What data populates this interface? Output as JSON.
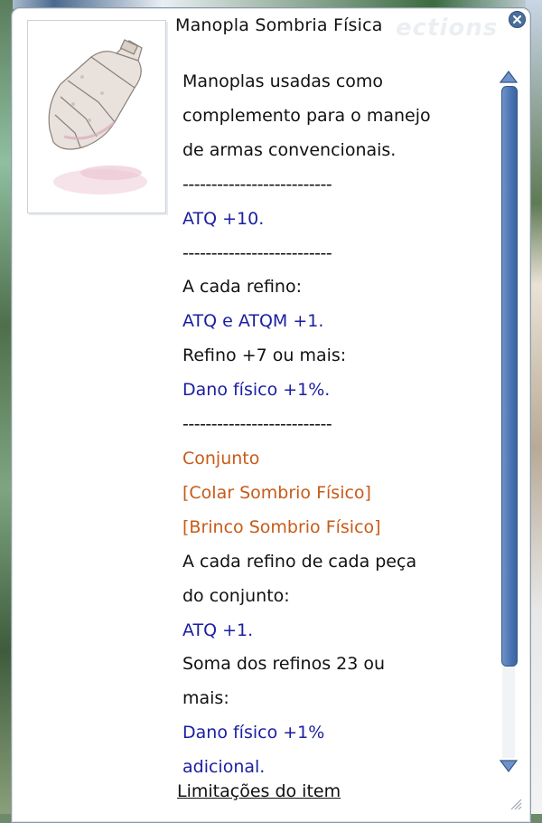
{
  "window": {
    "title": "Manopla Sombria Física",
    "watermark": "ections"
  },
  "item_image": {
    "icon": "gauntlet-icon"
  },
  "description": {
    "lines": [
      {
        "text": "Manoplas usadas como",
        "style": "normal"
      },
      {
        "text": "complemento para o manejo",
        "style": "normal"
      },
      {
        "text": "de armas convencionais.",
        "style": "normal"
      },
      {
        "text": "--------------------------",
        "style": "separator"
      },
      {
        "text": "ATQ +10.",
        "style": "blue"
      },
      {
        "text": "--------------------------",
        "style": "separator"
      },
      {
        "text": "A cada refino:",
        "style": "normal"
      },
      {
        "text": "ATQ e ATQM +1.",
        "style": "blue"
      },
      {
        "text": "Refino +7 ou mais:",
        "style": "normal"
      },
      {
        "text": "Dano físico +1%.",
        "style": "blue"
      },
      {
        "text": "--------------------------",
        "style": "separator"
      },
      {
        "text": "Conjunto",
        "style": "orange"
      },
      {
        "text": "[Colar Sombrio Físico]",
        "style": "orange"
      },
      {
        "text": "[Brinco Sombrio Físico]",
        "style": "orange"
      },
      {
        "text": "A cada refino de cada peça",
        "style": "normal"
      },
      {
        "text": "do conjunto:",
        "style": "normal"
      },
      {
        "text": "ATQ +1.",
        "style": "blue"
      },
      {
        "text": "Soma dos refinos 23 ou",
        "style": "normal"
      },
      {
        "text": "mais:",
        "style": "normal"
      },
      {
        "text": "Dano físico +1%",
        "style": "blue"
      },
      {
        "text": "adicional.",
        "style": "blue"
      }
    ],
    "footer_link": "Limitações do item"
  },
  "colors": {
    "blue_text": "#1b1fa0",
    "orange_text": "#c75b18",
    "scroll_thumb": "#4a73b3"
  }
}
